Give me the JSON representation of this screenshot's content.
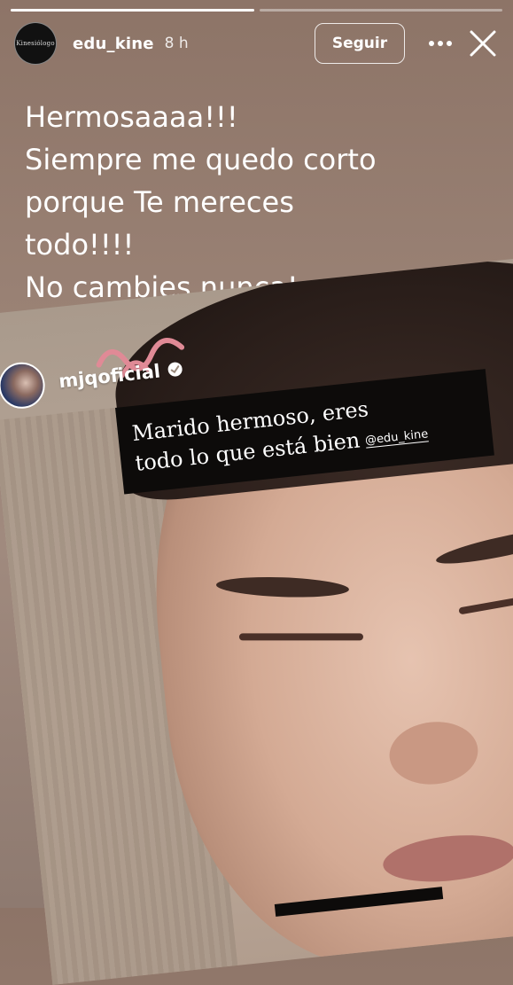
{
  "story": {
    "progress": [
      1.0,
      0.0
    ]
  },
  "header": {
    "avatar_text": "Kinesiólogo",
    "username": "edu_kine",
    "time": "8 h",
    "follow_label": "Seguir"
  },
  "caption": {
    "lines": [
      "Hermosaaaa!!!",
      "Siempre me quedo corto",
      "porque Te mereces",
      "todo!!!!",
      "No cambies nunca!"
    ]
  },
  "shared_post": {
    "username": "mjqoficial",
    "quote_lines": [
      "Marido hermoso, eres",
      "todo lo que está bien"
    ],
    "mention": "@edu_kine"
  },
  "icons": {
    "more": "more-horizontal-icon",
    "close": "close-icon",
    "verified": "verified-badge-icon"
  }
}
